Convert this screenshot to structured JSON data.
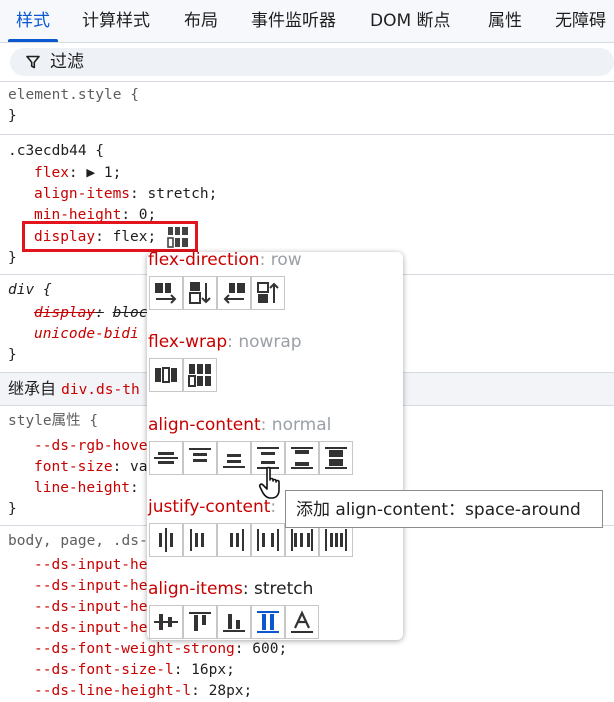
{
  "tabs": [
    {
      "label": "样式",
      "active": true
    },
    {
      "label": "计算样式",
      "active": false
    },
    {
      "label": "布局",
      "active": false
    },
    {
      "label": "事件监听器",
      "active": false
    },
    {
      "label": "DOM 断点",
      "active": false
    },
    {
      "label": "属性",
      "active": false
    },
    {
      "label": "无障碍",
      "active": false
    }
  ],
  "filter": {
    "label": "过滤",
    "icon": "funnel-icon"
  },
  "code": {
    "element_style_open": "element.style {",
    "close": "}",
    "rule1_selector": ".c3ecdb44 {",
    "rule1_props": [
      {
        "name": "flex",
        "value": "▶ 1;"
      },
      {
        "name": "align-items",
        "value": "stretch;"
      },
      {
        "name": "min-height",
        "value": "0;"
      },
      {
        "name": "display",
        "value": "flex;"
      }
    ],
    "rule2_selector": "div {",
    "rule2_props": [
      {
        "name": "display",
        "value": "block"
      },
      {
        "name": "unicode-bidi",
        "value": ""
      }
    ],
    "inherit_prefix": "继承自",
    "inherit_link": "div.ds-th",
    "style_attr": "style属性 {",
    "style_props": [
      {
        "name": "--ds-rgb-hove",
        "value": ""
      },
      {
        "name": "font-size",
        "value": "va"
      },
      {
        "name": "line-height",
        "value": ""
      }
    ],
    "body_selector": "body, page, .ds-",
    "body_props": [
      {
        "name": "--ds-input-he",
        "value": ""
      },
      {
        "name": "--ds-input-he",
        "value": ""
      },
      {
        "name": "--ds-input-he",
        "value": ""
      },
      {
        "name": "--ds-input-he",
        "value": ""
      },
      {
        "name": "--ds-font-weight-strong",
        "value": "600;"
      },
      {
        "name": "--ds-font-size-l",
        "value": "16px;"
      },
      {
        "name": "--ds-line-height-l",
        "value": "28px;"
      }
    ],
    "colon": ":"
  },
  "flex_editor": {
    "sections": [
      {
        "name": "flex-direction",
        "value": "row"
      },
      {
        "name": "flex-wrap",
        "value": "nowrap"
      },
      {
        "name": "align-content",
        "value": "normal"
      },
      {
        "name": "justify-content",
        "value": ""
      },
      {
        "name": "align-items",
        "value": "stretch"
      }
    ]
  },
  "tooltip": "添加 align-content：space-around",
  "colors": {
    "accent": "#0b57d0",
    "property": "#c80000",
    "highlight_box": "#e3141d"
  }
}
